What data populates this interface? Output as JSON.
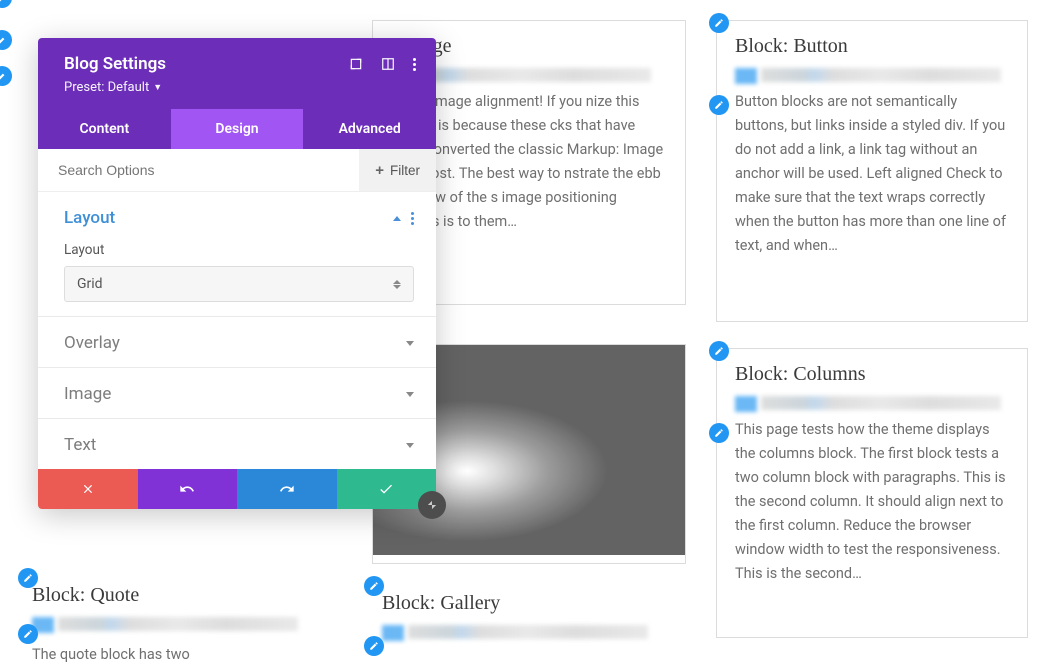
{
  "panel": {
    "title": "Blog Settings",
    "preset": "Preset: Default",
    "tabs": {
      "content": "Content",
      "design": "Design",
      "advanced": "Advanced"
    },
    "search_placeholder": "Search Options",
    "filter_label": "Filter",
    "sections": {
      "layout": {
        "title": "Layout",
        "field_label": "Layout",
        "selected": "Grid"
      },
      "overlay": "Overlay",
      "image": "Image",
      "text": "Text"
    }
  },
  "cards": {
    "image": {
      "title": ": Image",
      "body": "me to image alignment! If you nize this post, it is because these cks that have been converted the classic Markup: Image nent post. The best way to nstrate the ebb and flow of the s image positioning options is to them…"
    },
    "button": {
      "title": "Block: Button",
      "body": "Button blocks are not semantically buttons, but links inside a styled div.  If you do not add a link, a link tag without an anchor will be used. Left aligned Check to make sure that the text wraps correctly when the button has more than one line of text, and when…"
    },
    "columns": {
      "title": "Block: Columns",
      "body": "This page tests how the theme displays the columns block. The first block tests a two column block with paragraphs. This is the second column. It should align next to the first column. Reduce the browser window width to test the responsiveness. This is the second…"
    },
    "gallery": {
      "title": "Block: Gallery"
    },
    "quote": {
      "title": "Block: Quote",
      "body": "The quote block has two"
    }
  }
}
